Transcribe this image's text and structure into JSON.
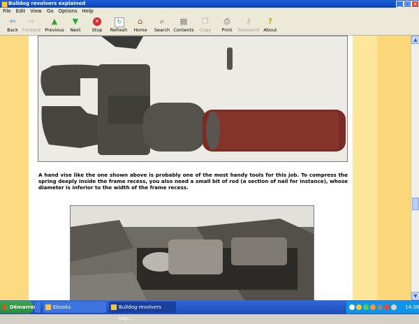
{
  "window": {
    "title": "Bulldog revolvers explained"
  },
  "menu": [
    "File",
    "Edit",
    "View",
    "Go",
    "Options",
    "Help"
  ],
  "toolbar": {
    "buttons": [
      {
        "label": "Back"
      },
      {
        "label": "Forward"
      },
      {
        "label": "Previous"
      },
      {
        "label": "Next"
      },
      {
        "label": "Stop"
      },
      {
        "label": "Refresh"
      },
      {
        "label": "Home"
      },
      {
        "label": "Search"
      },
      {
        "label": "Contents"
      },
      {
        "label": "Copy"
      },
      {
        "label": "Print"
      },
      {
        "label": "Password"
      },
      {
        "label": "About"
      }
    ]
  },
  "content": {
    "paragraph": "A hand vise like the one shown above is probably one of the most handy tools for this job. To compress the spring deeply inside the frame recess, you also need a small bit of rod (a section of nail for instance), whose diameter is inferior to the width of the frame recess."
  },
  "taskbar": {
    "start_label": "Démarrer",
    "tasks": [
      {
        "label": "Ebooks"
      },
      {
        "label": "Bulldog revolvers exp..."
      }
    ],
    "clock": "14:38"
  }
}
